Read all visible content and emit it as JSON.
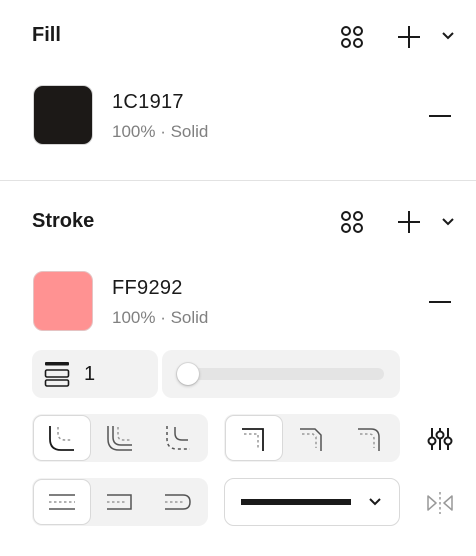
{
  "fill": {
    "title": "Fill",
    "color_hex": "1C1917",
    "color_value": "#1C1917",
    "meta": "100% · Solid"
  },
  "stroke": {
    "title": "Stroke",
    "color_hex": "FF9292",
    "color_value": "#FF9292",
    "meta": "100% · Solid",
    "weight": "1",
    "weight_slider_level": 0
  },
  "colors": {
    "text": "#1a1a1a",
    "muted": "#808080",
    "control_bg": "#f2f2f2",
    "active_bg": "#ffffff",
    "divider": "#e2e2e2"
  },
  "icons": {
    "styles": "grid-dots-icon",
    "add": "plus-icon",
    "expand": "chevron-down-icon",
    "remove": "minus-icon",
    "weight": "stroke-weight-icon",
    "settings": "sliders-icon",
    "mirror": "mirror-icon"
  }
}
